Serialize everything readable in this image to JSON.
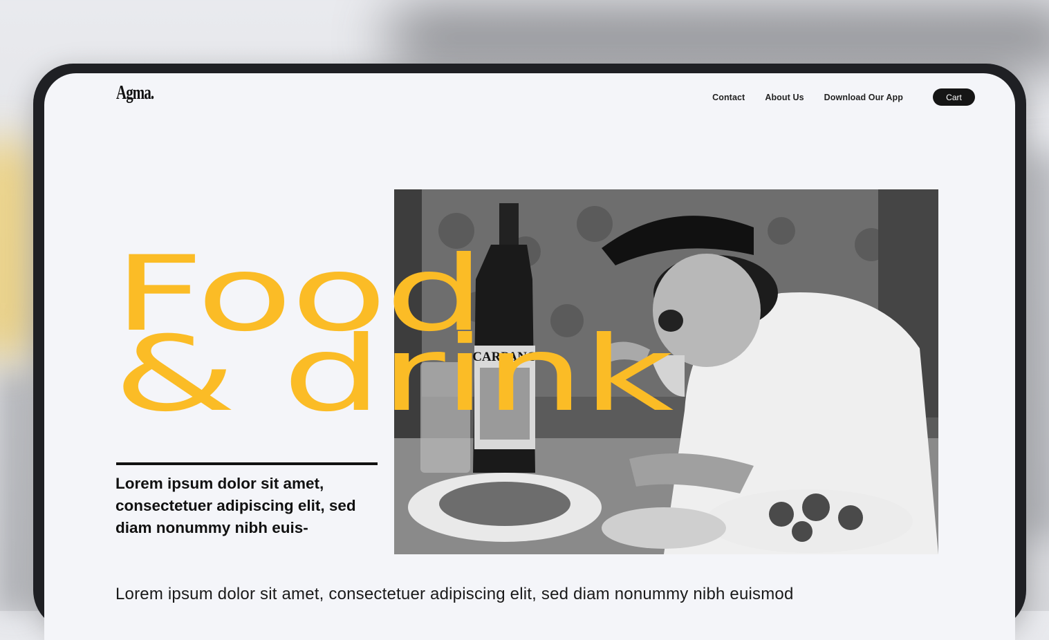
{
  "brand": {
    "logo_text": "Agma."
  },
  "nav": {
    "links": [
      "Contact",
      "About Us",
      "Download Our App"
    ],
    "cart_label": "Cart"
  },
  "hero": {
    "headline_line1": "Food",
    "headline_line2": "& drink",
    "photo_label": "CARPANO",
    "lead_text": "Lorem ipsum dolor sit amet, consectetuer adipiscing elit, sed diam nonummy nibh euis-",
    "body_text": "Lorem ipsum dolor sit amet, consectetuer adipiscing elit, sed diam nonummy nibh euismod"
  },
  "colors": {
    "accent": "#fbbc26",
    "text": "#111111",
    "screen_bg": "#f4f5f9",
    "frame": "#1f2024"
  }
}
